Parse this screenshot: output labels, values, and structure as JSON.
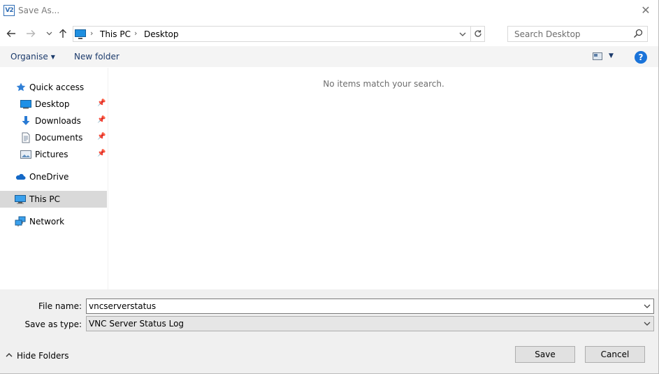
{
  "window": {
    "title": "Save As...",
    "app_icon_text": "V2",
    "close_glyph": "✕"
  },
  "address_bar": {
    "breadcrumbs": [
      "This PC",
      "Desktop"
    ],
    "separator": "›",
    "search_placeholder": "Search Desktop"
  },
  "toolbar": {
    "organise_label": "Organise",
    "new_folder_label": "New folder",
    "help_glyph": "?"
  },
  "nav_pane": {
    "items": [
      {
        "label": "Quick access",
        "icon": "star-icon",
        "pinned": false,
        "selected": false
      },
      {
        "label": "Desktop",
        "icon": "desktop-folder-icon",
        "pinned": true,
        "selected": false
      },
      {
        "label": "Downloads",
        "icon": "download-arrow-icon",
        "pinned": true,
        "selected": false
      },
      {
        "label": "Documents",
        "icon": "document-icon",
        "pinned": true,
        "selected": false
      },
      {
        "label": "Pictures",
        "icon": "picture-icon",
        "pinned": true,
        "selected": false
      },
      {
        "label": "OneDrive",
        "icon": "cloud-icon",
        "pinned": false,
        "selected": false
      },
      {
        "label": "This PC",
        "icon": "computer-icon",
        "pinned": false,
        "selected": true
      },
      {
        "label": "Network",
        "icon": "network-icon",
        "pinned": false,
        "selected": false
      }
    ]
  },
  "content": {
    "empty_message": "No items match your search."
  },
  "form": {
    "file_name_label": "File name:",
    "file_name_value": "vncserverstatus",
    "save_as_type_label": "Save as type:",
    "save_as_type_value": "VNC Server Status Log"
  },
  "footer": {
    "hide_folders_label": "Hide Folders",
    "save_label": "Save",
    "cancel_label": "Cancel"
  },
  "colors": {
    "accent": "#1a73d9",
    "selected_bg": "#d9d9d9",
    "panel_bg": "#f0f0f0"
  }
}
